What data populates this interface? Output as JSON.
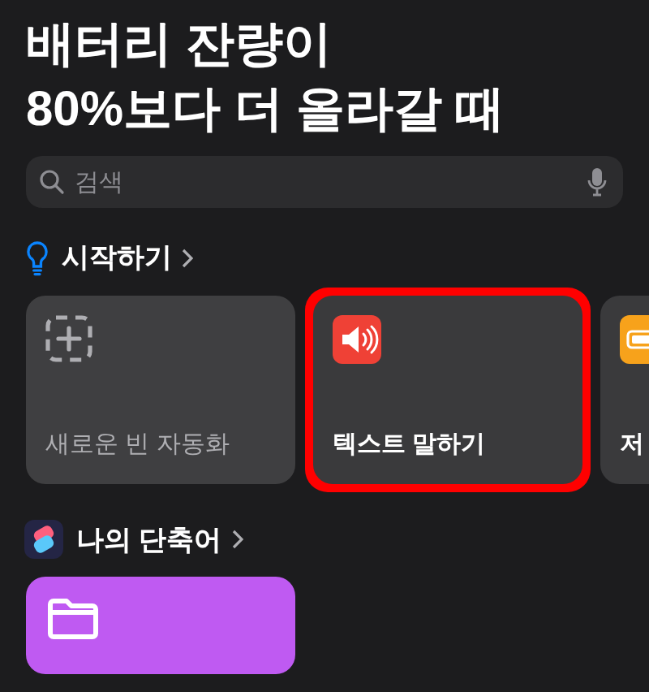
{
  "title_lines": [
    "배터리 잔량이",
    "80%보다 더 올라갈 때"
  ],
  "search": {
    "placeholder": "검색"
  },
  "sections": [
    {
      "title": "시작하기",
      "cards": [
        {
          "kind": "blank",
          "label": "새로운 빈 자동화",
          "highlighted": false
        },
        {
          "kind": "speaker",
          "color": "#ef4136",
          "label": "텍스트 말하기",
          "highlighted": true
        },
        {
          "kind": "battery",
          "color": "#f7a21b",
          "label": "저",
          "highlighted": false
        }
      ]
    },
    {
      "title": "나의 단축어",
      "cards": [
        {
          "kind": "folder",
          "color": "#bf5af2"
        }
      ]
    }
  ]
}
